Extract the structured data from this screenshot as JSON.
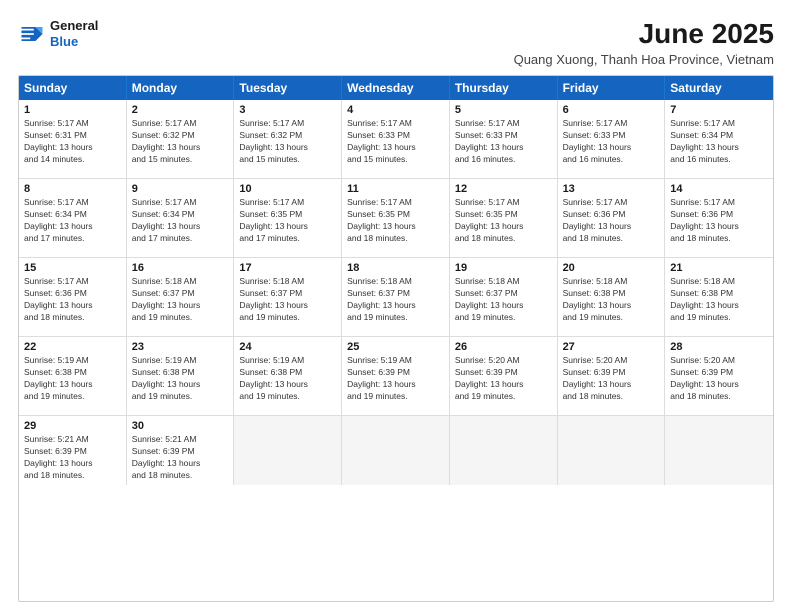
{
  "header": {
    "logo_line1": "General",
    "logo_line2": "Blue",
    "title": "June 2025",
    "subtitle": "Quang Xuong, Thanh Hoa Province, Vietnam"
  },
  "days_of_week": [
    "Sunday",
    "Monday",
    "Tuesday",
    "Wednesday",
    "Thursday",
    "Friday",
    "Saturday"
  ],
  "weeks": [
    [
      {
        "day": "1",
        "rise": "5:17 AM",
        "set": "6:31 PM",
        "daylight": "13 hours and 14 minutes."
      },
      {
        "day": "2",
        "rise": "5:17 AM",
        "set": "6:32 PM",
        "daylight": "13 hours and 15 minutes."
      },
      {
        "day": "3",
        "rise": "5:17 AM",
        "set": "6:32 PM",
        "daylight": "13 hours and 15 minutes."
      },
      {
        "day": "4",
        "rise": "5:17 AM",
        "set": "6:33 PM",
        "daylight": "13 hours and 15 minutes."
      },
      {
        "day": "5",
        "rise": "5:17 AM",
        "set": "6:33 PM",
        "daylight": "13 hours and 16 minutes."
      },
      {
        "day": "6",
        "rise": "5:17 AM",
        "set": "6:33 PM",
        "daylight": "13 hours and 16 minutes."
      },
      {
        "day": "7",
        "rise": "5:17 AM",
        "set": "6:34 PM",
        "daylight": "13 hours and 16 minutes."
      }
    ],
    [
      {
        "day": "8",
        "rise": "5:17 AM",
        "set": "6:34 PM",
        "daylight": "13 hours and 17 minutes."
      },
      {
        "day": "9",
        "rise": "5:17 AM",
        "set": "6:34 PM",
        "daylight": "13 hours and 17 minutes."
      },
      {
        "day": "10",
        "rise": "5:17 AM",
        "set": "6:35 PM",
        "daylight": "13 hours and 17 minutes."
      },
      {
        "day": "11",
        "rise": "5:17 AM",
        "set": "6:35 PM",
        "daylight": "13 hours and 18 minutes."
      },
      {
        "day": "12",
        "rise": "5:17 AM",
        "set": "6:35 PM",
        "daylight": "13 hours and 18 minutes."
      },
      {
        "day": "13",
        "rise": "5:17 AM",
        "set": "6:36 PM",
        "daylight": "13 hours and 18 minutes."
      },
      {
        "day": "14",
        "rise": "5:17 AM",
        "set": "6:36 PM",
        "daylight": "13 hours and 18 minutes."
      }
    ],
    [
      {
        "day": "15",
        "rise": "5:17 AM",
        "set": "6:36 PM",
        "daylight": "13 hours and 18 minutes."
      },
      {
        "day": "16",
        "rise": "5:18 AM",
        "set": "6:37 PM",
        "daylight": "13 hours and 19 minutes."
      },
      {
        "day": "17",
        "rise": "5:18 AM",
        "set": "6:37 PM",
        "daylight": "13 hours and 19 minutes."
      },
      {
        "day": "18",
        "rise": "5:18 AM",
        "set": "6:37 PM",
        "daylight": "13 hours and 19 minutes."
      },
      {
        "day": "19",
        "rise": "5:18 AM",
        "set": "6:37 PM",
        "daylight": "13 hours and 19 minutes."
      },
      {
        "day": "20",
        "rise": "5:18 AM",
        "set": "6:38 PM",
        "daylight": "13 hours and 19 minutes."
      },
      {
        "day": "21",
        "rise": "5:18 AM",
        "set": "6:38 PM",
        "daylight": "13 hours and 19 minutes."
      }
    ],
    [
      {
        "day": "22",
        "rise": "5:19 AM",
        "set": "6:38 PM",
        "daylight": "13 hours and 19 minutes."
      },
      {
        "day": "23",
        "rise": "5:19 AM",
        "set": "6:38 PM",
        "daylight": "13 hours and 19 minutes."
      },
      {
        "day": "24",
        "rise": "5:19 AM",
        "set": "6:38 PM",
        "daylight": "13 hours and 19 minutes."
      },
      {
        "day": "25",
        "rise": "5:19 AM",
        "set": "6:39 PM",
        "daylight": "13 hours and 19 minutes."
      },
      {
        "day": "26",
        "rise": "5:20 AM",
        "set": "6:39 PM",
        "daylight": "13 hours and 19 minutes."
      },
      {
        "day": "27",
        "rise": "5:20 AM",
        "set": "6:39 PM",
        "daylight": "13 hours and 18 minutes."
      },
      {
        "day": "28",
        "rise": "5:20 AM",
        "set": "6:39 PM",
        "daylight": "13 hours and 18 minutes."
      }
    ],
    [
      {
        "day": "29",
        "rise": "5:21 AM",
        "set": "6:39 PM",
        "daylight": "13 hours and 18 minutes."
      },
      {
        "day": "30",
        "rise": "5:21 AM",
        "set": "6:39 PM",
        "daylight": "13 hours and 18 minutes."
      },
      {
        "day": "",
        "rise": "",
        "set": "",
        "daylight": ""
      },
      {
        "day": "",
        "rise": "",
        "set": "",
        "daylight": ""
      },
      {
        "day": "",
        "rise": "",
        "set": "",
        "daylight": ""
      },
      {
        "day": "",
        "rise": "",
        "set": "",
        "daylight": ""
      },
      {
        "day": "",
        "rise": "",
        "set": "",
        "daylight": ""
      }
    ]
  ]
}
